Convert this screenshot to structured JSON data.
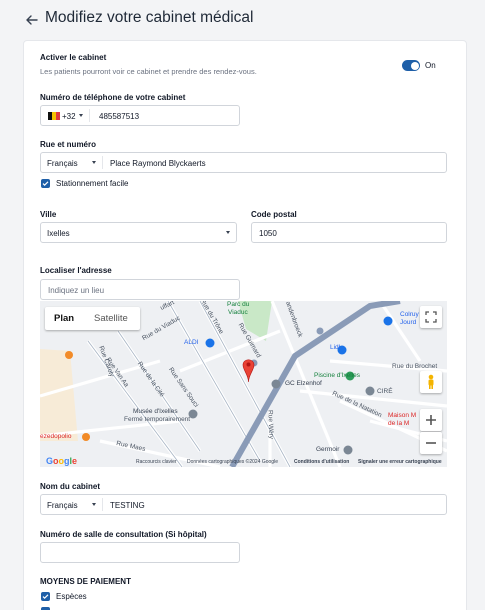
{
  "header": {
    "title": "Modifiez votre cabinet médical"
  },
  "activate": {
    "label": "Activer le cabinet",
    "description": "Les patients pourront voir ce cabinet et prendre des rendez-vous.",
    "toggle_state": "On"
  },
  "phone": {
    "label": "Numéro de téléphone de votre cabinet",
    "country_code": "+32",
    "value": "485587513"
  },
  "address": {
    "label": "Rue et numéro",
    "language": "Français",
    "value": "Place Raymond Blyckaerts",
    "parking_label": "Stationnement facile",
    "parking_checked": true
  },
  "city": {
    "label": "Ville",
    "value": "Ixelles"
  },
  "postal": {
    "label": "Code postal",
    "value": "1050"
  },
  "locate": {
    "label": "Localiser l'adresse",
    "placeholder": "Indiquez un lieu"
  },
  "map": {
    "tab_plan": "Plan",
    "tab_satellite": "Satellite",
    "labels": {
      "parc_du": "Parc du",
      "viaduc": "Viaduc",
      "rue_du_viaduc": "Rue du Viaduc",
      "rue_du_trone": "Rue du Trône",
      "aldi": "ALDI",
      "lidl": "Lidl",
      "colruyt": "Colruy",
      "jourd": "Jourd",
      "piscine": "Piscine d'Ixelles",
      "gc_elzenhof": "GC Elzenhof",
      "cire": "CIRÉ",
      "musee": "Musée d'Ixelles",
      "ferme": "Fermé temporairement",
      "rue_van_aa": "Rue Van Aa",
      "rue_de_la_cite": "Rue de la Cité",
      "rue_sans_souci": "Rue Sans Souci",
      "rue_gray": "Rue Gray",
      "rue_maes": "Rue Maes",
      "rue_wery": "Rue Wéry",
      "rue_de_la_natation": "Rue de la Natation",
      "rue_du_brochet": "Rue du Brochet",
      "rue_caroly": "Rue Caroly",
      "maison": "Maison M",
      "de_la_m": "de la M",
      "germoir": "Germoir",
      "ezedopolio": "ezedopolio",
      "rue_guimard": "Rue Guimard",
      "uffart": "uffart",
      "andenbroeck": "andenbroeck"
    },
    "footer": {
      "shortcuts": "Raccourcis clavier",
      "data": "Données cartographiques ©2024 Google",
      "terms": "Conditions d'utilisation",
      "report": "Signaler une erreur cartographique"
    },
    "logo": "Google"
  },
  "cabinet_name": {
    "label": "Nom du cabinet",
    "language": "Français",
    "value": "TESTING"
  },
  "room": {
    "label": "Numéro de salle de consultation (Si hôpital)",
    "value": ""
  },
  "payment": {
    "heading": "MOYENS DE PAIEMENT",
    "cash_label": "Espèces",
    "cash_checked": true
  },
  "colors": {
    "accent": "#1e5fa8",
    "flag_black": "#111111",
    "flag_yellow": "#f5c400",
    "flag_red": "#e03a3e"
  }
}
